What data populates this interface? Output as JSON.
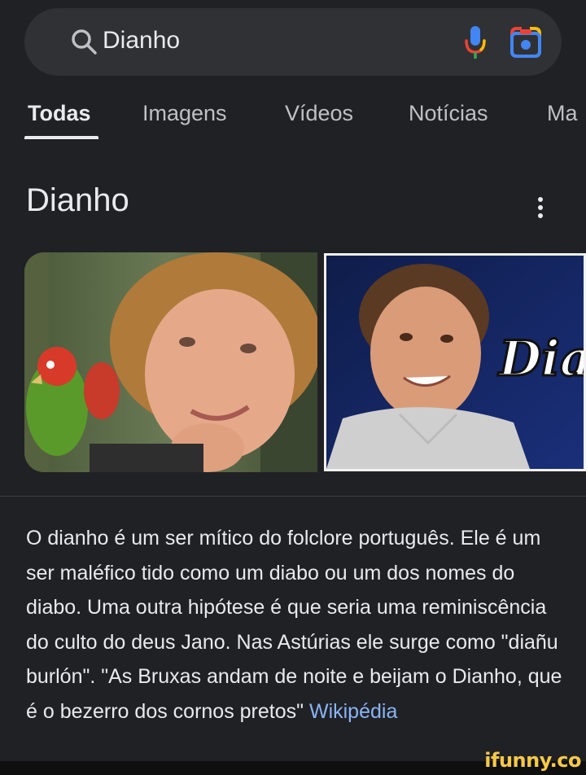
{
  "search": {
    "query": "Dianho"
  },
  "tabs": [
    {
      "label": "Todas",
      "active": true
    },
    {
      "label": "Imagens",
      "active": false
    },
    {
      "label": "Vídeos",
      "active": false
    },
    {
      "label": "Notícias",
      "active": false
    },
    {
      "label": "Ma",
      "active": false
    }
  ],
  "knowledge_panel": {
    "title": "Dianho",
    "image_right_caption": "Dia",
    "description": "O dianho é um ser mítico do folclore português. Ele é um ser maléfico tido como um diabo ou um dos nomes do diabo. Uma outra hipótese é que seria uma reminiscência do culto do deus Jano. Nas Astúrias ele surge como \"diañu burlón\". \"As Bruxas andam de noite e beijam o Dianho, que é o bezerro dos cornos pretos\"",
    "source_link": "Wikipédia"
  },
  "watermark": "ifunny.co",
  "colors": {
    "background": "#202124",
    "search_bar": "#303134",
    "link": "#8ab4f8",
    "text": "#e8eaed",
    "muted_text": "#bdc1c6"
  },
  "icons": {
    "search": "search-icon",
    "mic": "mic-icon",
    "lens": "google-lens-icon",
    "more": "more-vert-icon"
  }
}
